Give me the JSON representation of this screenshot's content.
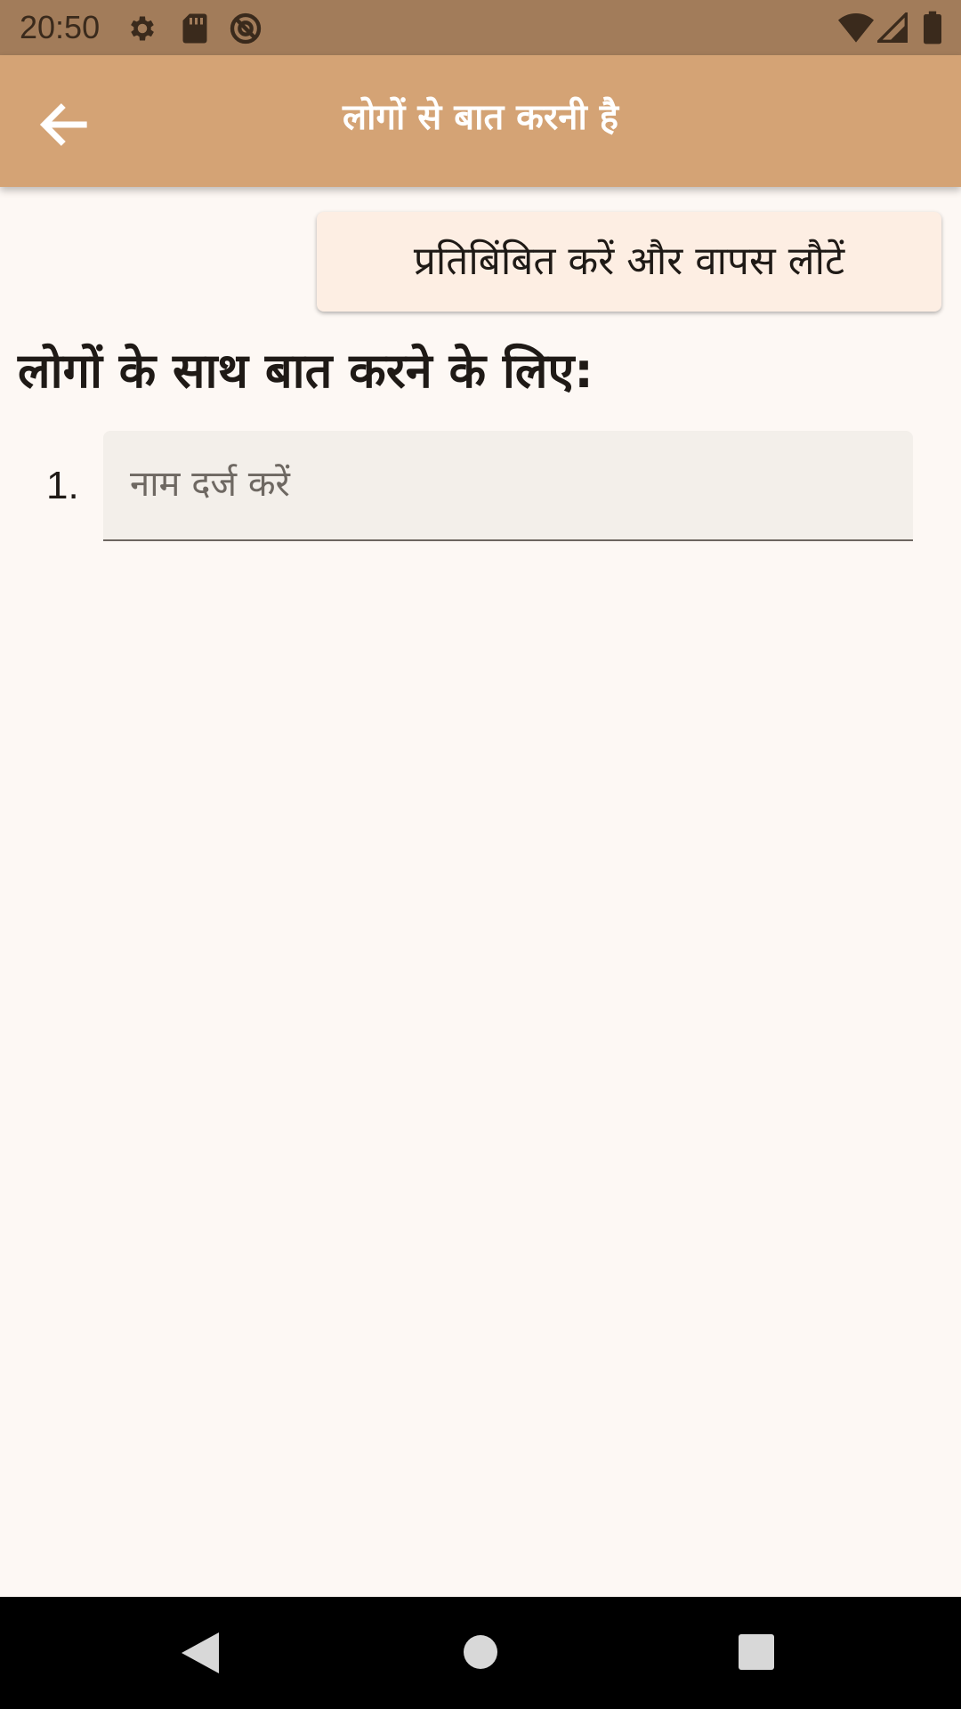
{
  "status_bar": {
    "time": "20:50",
    "left_icons": [
      "settings-icon",
      "sd-card-icon",
      "data-saver-icon"
    ],
    "right_icons": [
      "wifi-icon",
      "cellular-signal-icon",
      "battery-icon"
    ]
  },
  "app_bar": {
    "title": "लोगों से बात करनी है",
    "back_icon": "arrow-back-icon",
    "color": "#d4a375"
  },
  "reflect_button": {
    "label": "प्रतिबिंबित करें और वापस लौटें"
  },
  "section": {
    "heading": "लोगों के साथ बात करने के लिए:"
  },
  "people_list": [
    {
      "number": "1.",
      "value": "",
      "placeholder": "नाम दर्ज करें"
    }
  ],
  "nav_bar": {
    "icons": [
      "back-triangle-icon",
      "home-circle-icon",
      "recents-square-icon"
    ]
  }
}
